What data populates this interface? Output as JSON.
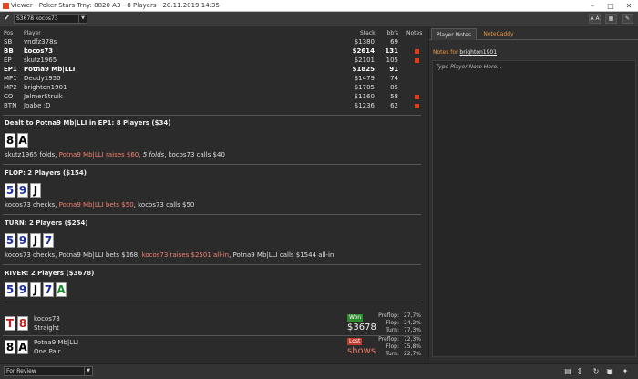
{
  "window": {
    "title": "Viewer - Poker Stars Trny: 8820 A3 - 8 Players - 20.11.2019 14:35"
  },
  "toolbar": {
    "player_select": "S3678 kocos73",
    "btn_aa": "A A",
    "btn_grid": "▦",
    "btn_list": "☰",
    "btn_edit": "✎"
  },
  "table": {
    "headers": {
      "pos": "Pos",
      "player": "Player",
      "stack": "Stack",
      "bbs": "bb's",
      "notes": "Notes"
    },
    "rows": [
      {
        "pos": "SB",
        "player": "vndfz378s",
        "stack": "$1380",
        "bbs": "69",
        "note": false,
        "bold": false
      },
      {
        "pos": "BB",
        "player": "kocos73",
        "stack": "$2614",
        "bbs": "131",
        "note": true,
        "bold": true
      },
      {
        "pos": "EP",
        "player": "skutz1965",
        "stack": "$2101",
        "bbs": "105",
        "note": true,
        "bold": false
      },
      {
        "pos": "EP1",
        "player": "Potna9 Mb|LLI",
        "stack": "$1825",
        "bbs": "91",
        "note": false,
        "bold": true
      },
      {
        "pos": "MP1",
        "player": "Deddy1950",
        "stack": "$1479",
        "bbs": "74",
        "note": false,
        "bold": false
      },
      {
        "pos": "MP2",
        "player": "brighton1901",
        "stack": "$1705",
        "bbs": "85",
        "note": false,
        "bold": false
      },
      {
        "pos": "CO",
        "player": "JelmerStruik",
        "stack": "$1160",
        "bbs": "58",
        "note": true,
        "bold": false
      },
      {
        "pos": "BTN",
        "player": "Joabe ;D",
        "stack": "$1236",
        "bbs": "62",
        "note": true,
        "bold": false
      }
    ]
  },
  "preflop": {
    "title": "Dealt to Potna9 Mb|LLI in EP1: 8 Players ($34)",
    "cards": [
      {
        "rank": "8",
        "color": "#000000"
      },
      {
        "rank": "A",
        "color": "#000000"
      }
    ],
    "actions": [
      {
        "text": "skutz1965 folds, ",
        "style": "normal"
      },
      {
        "text": "Potna9 Mb|LLI raises $60, ",
        "style": "red"
      },
      {
        "text": "5 folds",
        "style": "italic"
      },
      {
        "text": ", kocos73 calls $40",
        "style": "normal"
      }
    ]
  },
  "flop": {
    "title": "FLOP: 2 Players ($154)",
    "cards": [
      {
        "rank": "5",
        "color": "#1c2f9a"
      },
      {
        "rank": "9",
        "color": "#1c2f9a"
      },
      {
        "rank": "J",
        "color": "#000000"
      }
    ],
    "actions": [
      {
        "text": "kocos73 checks, ",
        "style": "normal"
      },
      {
        "text": "Potna9 Mb|LLI bets $50",
        "style": "red"
      },
      {
        "text": ", kocos73 calls $50",
        "style": "normal"
      }
    ]
  },
  "turn": {
    "title": "TURN: 2 Players ($254)",
    "cards": [
      {
        "rank": "5",
        "color": "#1c2f9a"
      },
      {
        "rank": "9",
        "color": "#1c2f9a"
      },
      {
        "rank": "J",
        "color": "#000000"
      },
      {
        "rank": "7",
        "color": "#1c2f9a"
      }
    ],
    "actions": [
      {
        "text": "kocos73 checks, Potna9 Mb|LLI bets $168, ",
        "style": "normal"
      },
      {
        "text": "kocos73 raises $2501 all-in",
        "style": "red"
      },
      {
        "text": ", Potna9 Mb|LLI calls $1544 all-in",
        "style": "normal"
      }
    ]
  },
  "river": {
    "title": "RIVER: 2 Players ($3678)",
    "cards": [
      {
        "rank": "5",
        "color": "#1c2f9a"
      },
      {
        "rank": "9",
        "color": "#1c2f9a"
      },
      {
        "rank": "J",
        "color": "#000000"
      },
      {
        "rank": "7",
        "color": "#1c2f9a"
      },
      {
        "rank": "A",
        "color": "#1a8a2a"
      }
    ]
  },
  "showdown": [
    {
      "cards": [
        {
          "rank": "T",
          "color": "#c02020"
        },
        {
          "rank": "8",
          "color": "#c02020"
        }
      ],
      "player": "kocos73",
      "hand": "Straight",
      "result": "Won",
      "result_color": "#2e8b2e",
      "amount": "$3678",
      "stats": {
        "preflop_label": "Preflop:",
        "preflop": "27,7%",
        "flop_label": "Flop:",
        "flop": "24,2%",
        "turn_label": "Turn:",
        "turn": "77,3%"
      }
    },
    {
      "cards": [
        {
          "rank": "8",
          "color": "#000000"
        },
        {
          "rank": "A",
          "color": "#000000"
        }
      ],
      "player": "Potna9 Mb|LLI",
      "hand": "One Pair",
      "result": "Lost",
      "result_color": "#c0392b",
      "amount": "shows",
      "stats": {
        "preflop_label": "Preflop:",
        "preflop": "72,3%",
        "flop_label": "Flop:",
        "flop": "75,8%",
        "turn_label": "Turn:",
        "turn": "22,7%"
      }
    }
  ],
  "notes_panel": {
    "tabs": [
      "Player Notes",
      "NoteCaddy"
    ],
    "active_tab": 0,
    "notes_for_label": "Notes for",
    "notes_for_player": "brighton1901",
    "placeholder": "Type Player Note Here..."
  },
  "statusbar": {
    "review_select": "For Review"
  },
  "colors": {
    "accent_orange": "#e8963c",
    "flag_red": "#e23a1a",
    "action_red": "#f08070"
  }
}
